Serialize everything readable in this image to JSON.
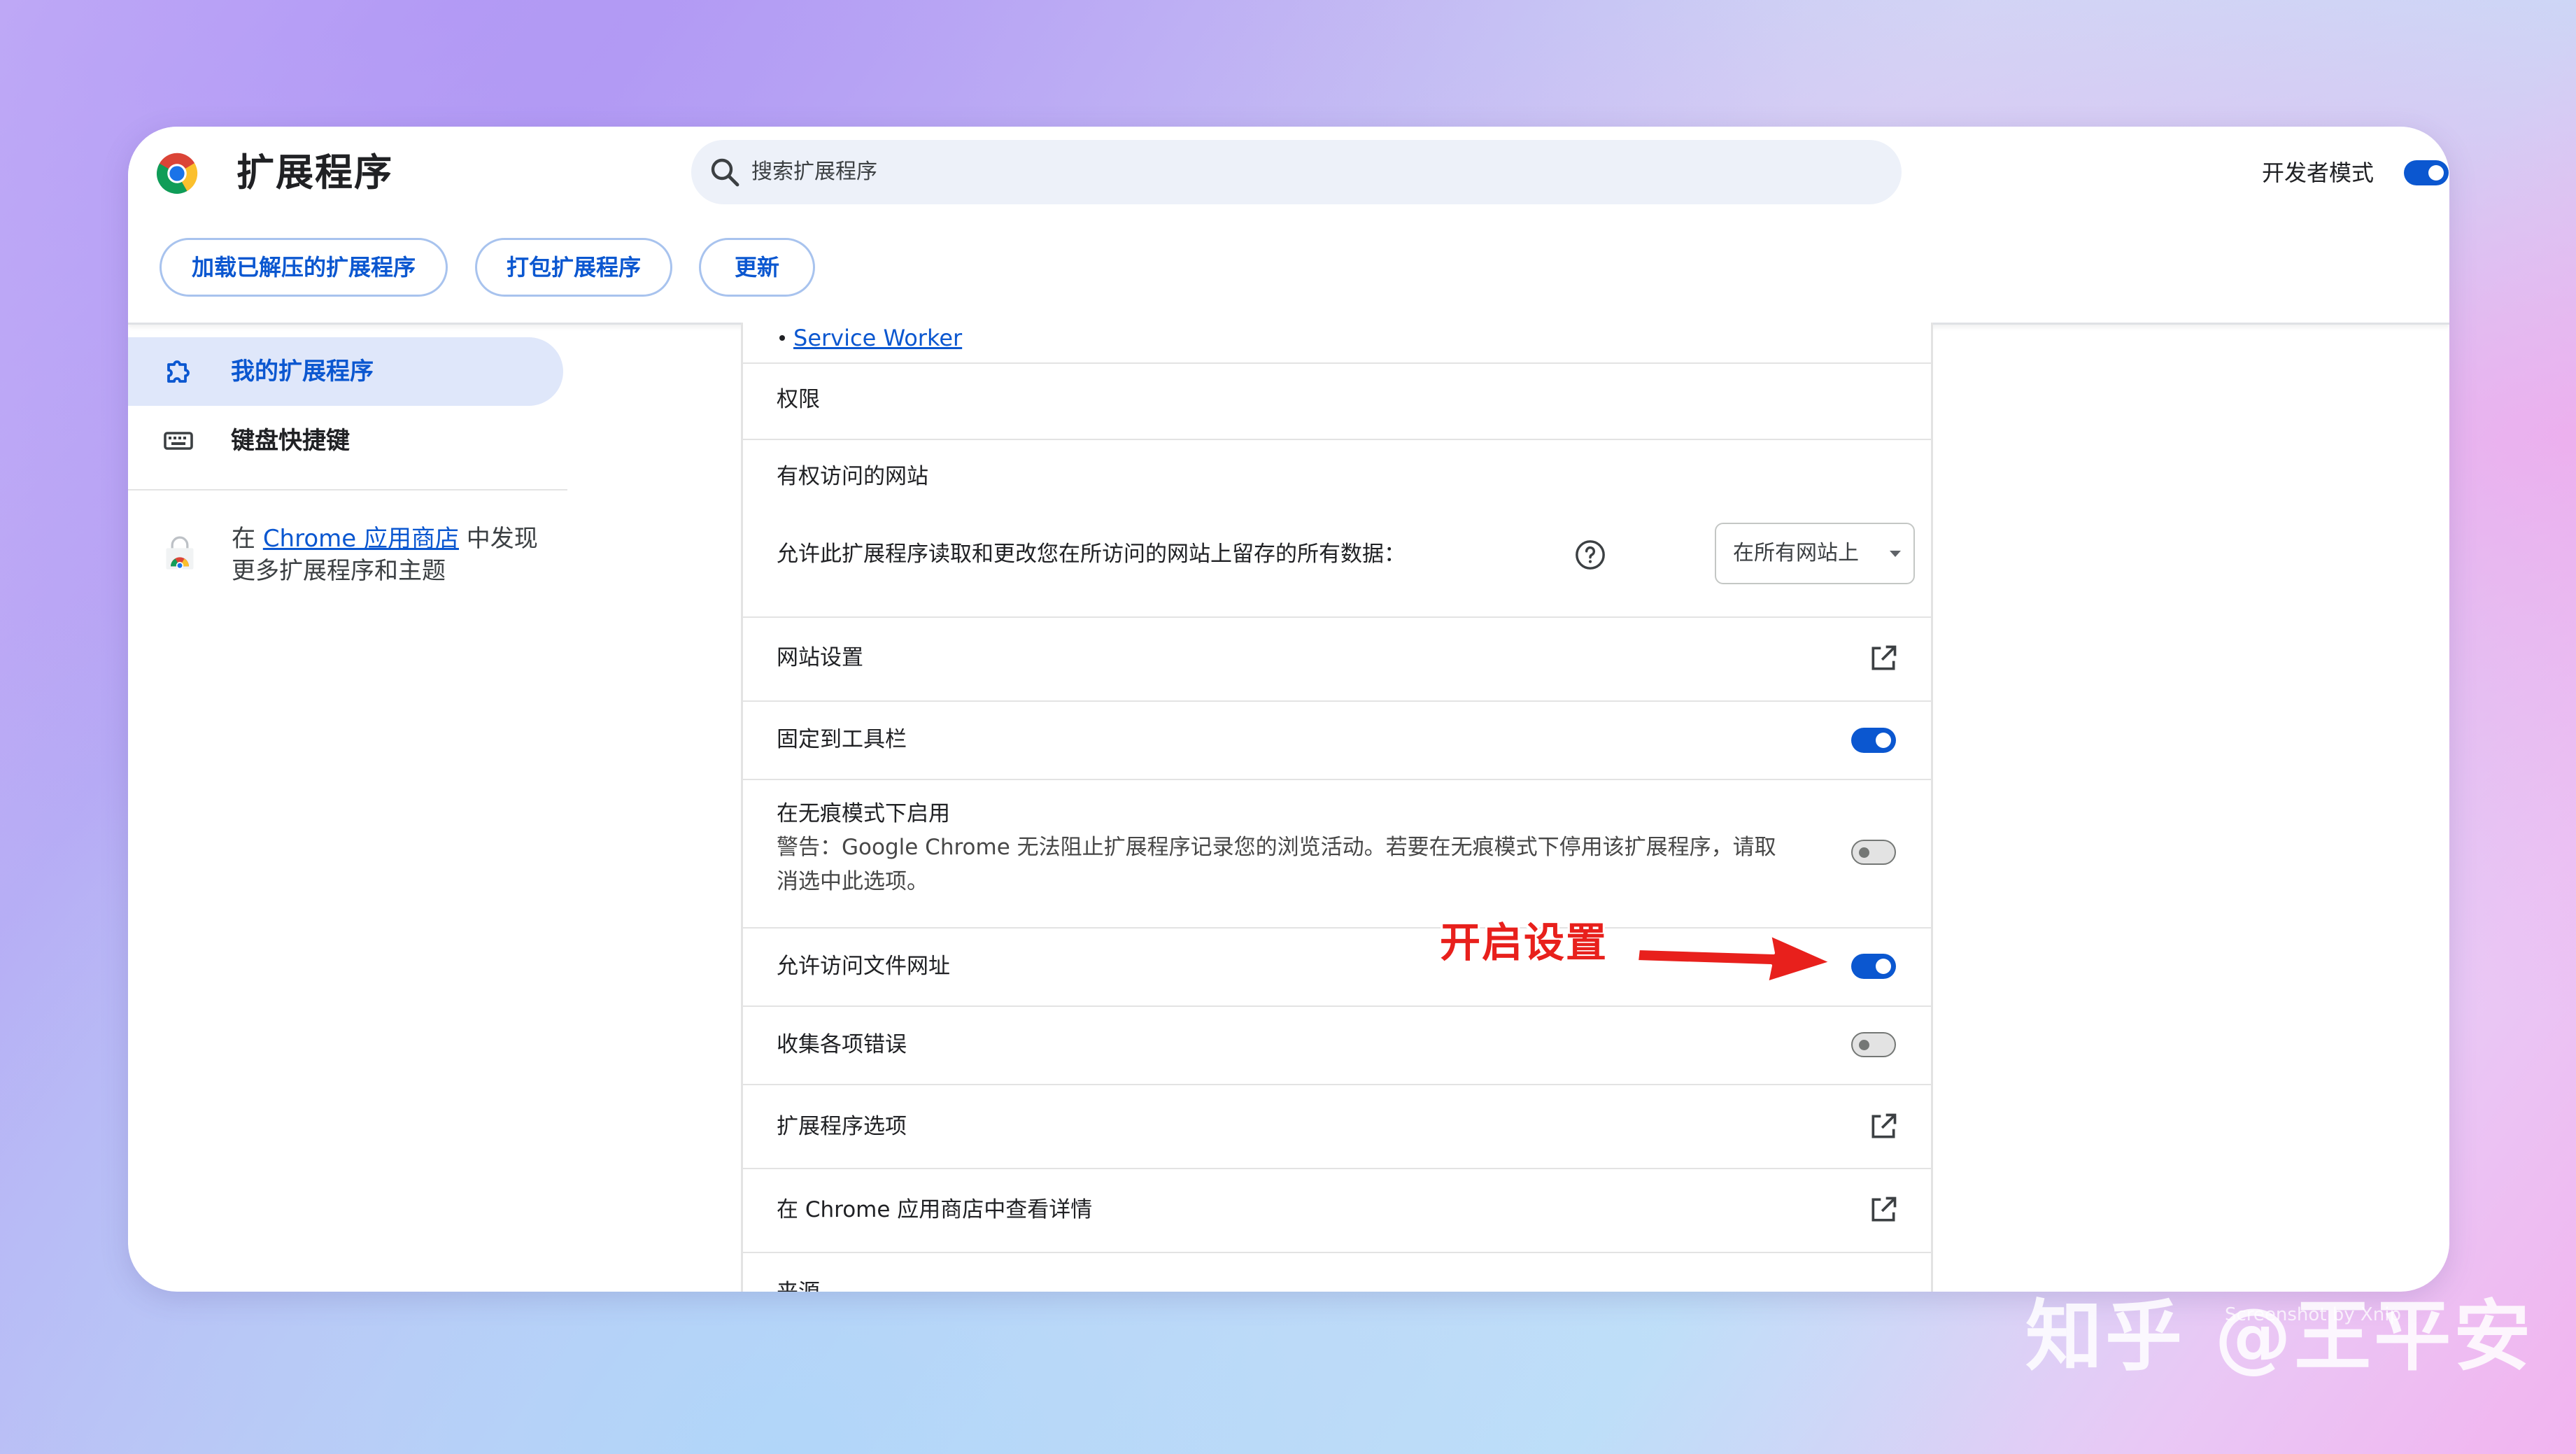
{
  "header": {
    "title": "扩展程序",
    "search_placeholder": "搜索扩展程序",
    "dev_mode_label": "开发者模式",
    "dev_mode_on": true
  },
  "toolbar": {
    "load_unpacked": "加载已解压的扩展程序",
    "pack": "打包扩展程序",
    "update": "更新"
  },
  "sidebar": {
    "items": [
      {
        "label": "我的扩展程序",
        "icon": "extension-icon",
        "active": true
      },
      {
        "label": "键盘快捷键",
        "icon": "keyboard-icon",
        "active": false
      }
    ],
    "store_prefix": "在 ",
    "store_link": "Chrome 应用商店",
    "store_suffix": " 中发现",
    "store_line2": "更多扩展程序和主题"
  },
  "details": {
    "service_worker_link": "Service Worker",
    "permissions": "权限",
    "site_access_title": "有权访问的网站",
    "site_access_desc": "允许此扩展程序读取和更改您在所访问的网站上留存的所有数据：",
    "site_access_value": "在所有网站上",
    "site_settings": "网站设置",
    "pin_toolbar": "固定到工具栏",
    "pin_toolbar_on": true,
    "incognito_title": "在无痕模式下启用",
    "incognito_warning_line1": "警告：Google Chrome 无法阻止扩展程序记录您的浏览活动。若要在无痕模式下停用该扩展程序，请取",
    "incognito_warning_line2": "消选中此选项。",
    "incognito_on": false,
    "file_urls": "允许访问文件网址",
    "file_urls_on": true,
    "collect_errors": "收集各项错误",
    "collect_errors_on": false,
    "extension_options": "扩展程序选项",
    "view_in_store": "在 Chrome 应用商店中查看详情",
    "source": "来源"
  },
  "annotation": {
    "text": "开启设置",
    "color": "#e8201c"
  },
  "watermark": {
    "text": "知乎 @王平安",
    "small_text": "Screenshot by Xnip"
  },
  "colors": {
    "accent": "#0b57d0",
    "active_nav_bg": "#dfe7fa"
  }
}
